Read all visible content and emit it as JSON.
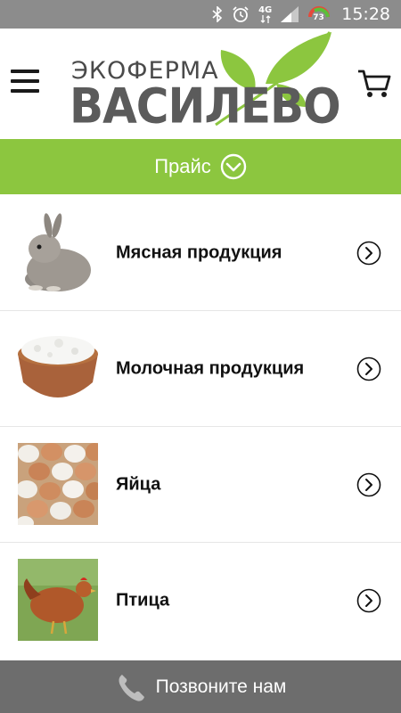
{
  "status_bar": {
    "time": "15:28",
    "network_label": "4G",
    "battery_level": "73",
    "icons": [
      "bluetooth-icon",
      "alarm-icon",
      "network-4g-icon",
      "signal-icon",
      "battery-icon"
    ]
  },
  "header": {
    "logo_top": "ЭКОФЕРМА",
    "logo_main": "ВАСИЛЕВО",
    "menu_icon": "hamburger-menu-icon",
    "cart_icon": "shopping-cart-icon"
  },
  "price_bar": {
    "label": "Прайс",
    "icon": "chevron-down-circle-icon"
  },
  "categories": [
    {
      "label": "Мясная продукция",
      "image": "rabbit"
    },
    {
      "label": "Молочная продукция",
      "image": "cottage-cheese"
    },
    {
      "label": "Яйца",
      "image": "eggs"
    },
    {
      "label": "Птица",
      "image": "hen"
    }
  ],
  "call_bar": {
    "label": "Позвоните нам",
    "icon": "phone-icon"
  },
  "colors": {
    "accent_green": "#8cc63f",
    "status_bar": "#8c8c8c",
    "call_bar": "#6d6d6d",
    "logo_gray": "#5b5b5b"
  }
}
